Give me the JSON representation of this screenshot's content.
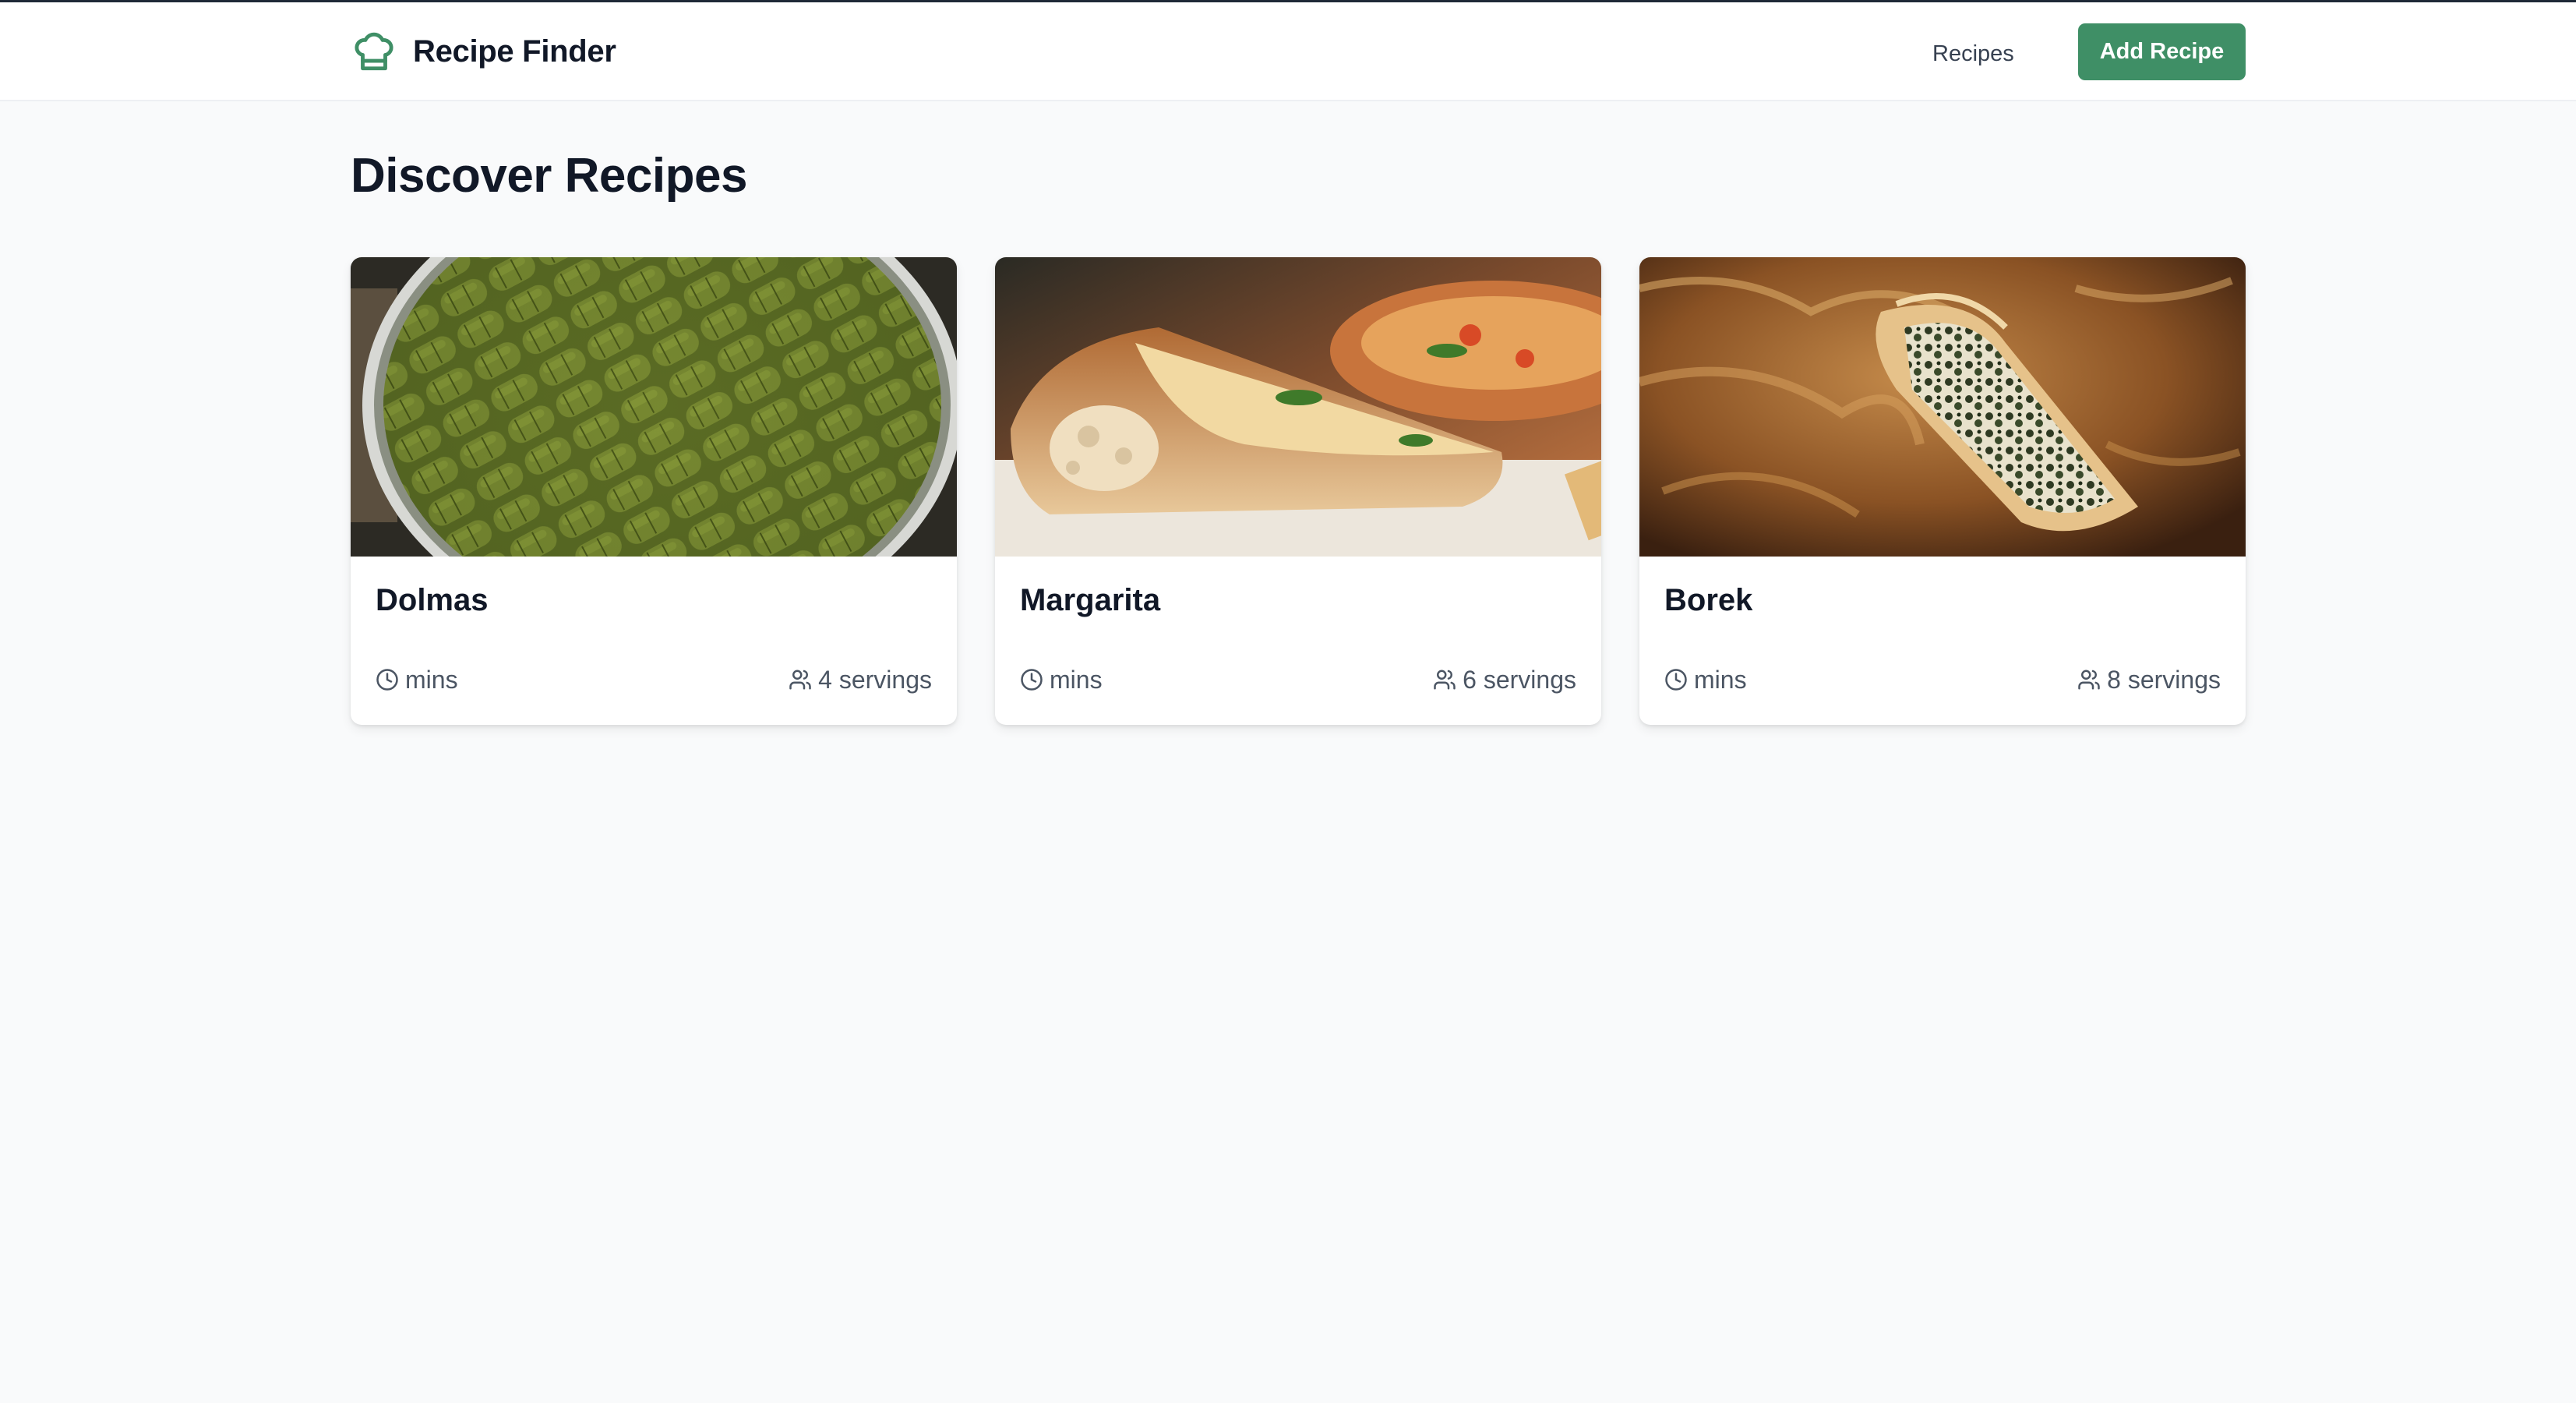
{
  "header": {
    "brand_name": "Recipe Finder",
    "logo_icon": "chef-hat-icon",
    "nav_link": "Recipes",
    "add_button": "Add Recipe",
    "accent_color": "#3f8f66"
  },
  "main": {
    "title": "Discover Recipes",
    "recipes": [
      {
        "name": "Dolmas",
        "time": "mins",
        "servings": "4 servings",
        "image": "stuffed-grape-leaves-photo"
      },
      {
        "name": "Margarita",
        "time": "mins",
        "servings": "6 servings",
        "image": "pizza-slice-photo"
      },
      {
        "name": "Borek",
        "time": "mins",
        "servings": "8 servings",
        "image": "spinach-borek-photo"
      }
    ]
  }
}
